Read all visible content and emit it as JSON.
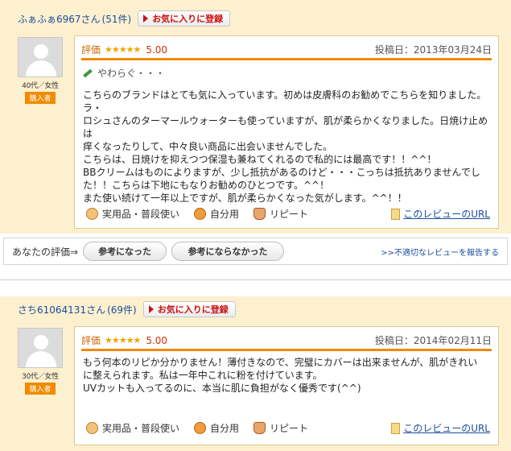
{
  "reviews": [
    {
      "user_name": "ふぁふぁ6967さん",
      "count": "(51件)",
      "favorite_label": "お気に入りに登録",
      "age_gender": "40代／女性",
      "buyer_badge": "購入者",
      "rating_label": "評価",
      "stars": "★★★★★",
      "score": "5.00",
      "posted": "投稿日：2013年03月24日",
      "title": "やわらぐ・・・",
      "body": [
        "こちらのブランドはとても気に入っています。初めは皮膚科のお勧めでこちらを知りました。ラ・",
        "ロシュさんのターマールウォーターも使っていますが、肌が柔らかくなりました。日焼け止めは",
        "痒くなったりして、中々良い商品に出会いませんでした。",
        "こちらは、日焼けを抑えつつ保湿も兼ねてくれるので私的には最高です！！^^！",
        "BBクリームはものによりますが、少し抵抗があるのけど・・・こっちは抵抗ありませんでし",
        "た！！こちらは下地にもなりお勧めのひとつです。^^！",
        "また使い続けて一年以上ですが、肌が柔らかくなった気がします。^^！！"
      ],
      "tags": [
        "実用品・普段使い",
        "自分用",
        "リピート"
      ],
      "url_label": "このレビューのURL"
    },
    {
      "user_name": "さち61064131さん",
      "count": "(69件)",
      "favorite_label": "お気に入りに登録",
      "age_gender": "30代／女性",
      "buyer_badge": "購入者",
      "rating_label": "評価",
      "stars": "★★★★★",
      "score": "5.00",
      "posted": "投稿日：2014年02月11日",
      "body": [
        "もう何本のリピか分かりません！薄付きなので、完璧にカバーは出来ませんが、肌がきれい",
        "に整えられます。私は一年中これに粉を付けています。",
        "UVカットも入ってるのに、本当に肌に負担がなく優秀です(^^)"
      ],
      "tags": [
        "実用品・普段使い",
        "自分用",
        "リピート"
      ],
      "url_label": "このレビューのURL"
    }
  ],
  "vote": {
    "label": "あなたの評価⇒",
    "helpful": "参考になった",
    "not_helpful": "参考にならなかった",
    "report": ">>不適切なレビューを報告する"
  },
  "colors": {
    "accent": "#f08a00",
    "panel_bg": "#fdf0cf",
    "link": "#1a4d9a",
    "fav_red": "#cc1111"
  }
}
